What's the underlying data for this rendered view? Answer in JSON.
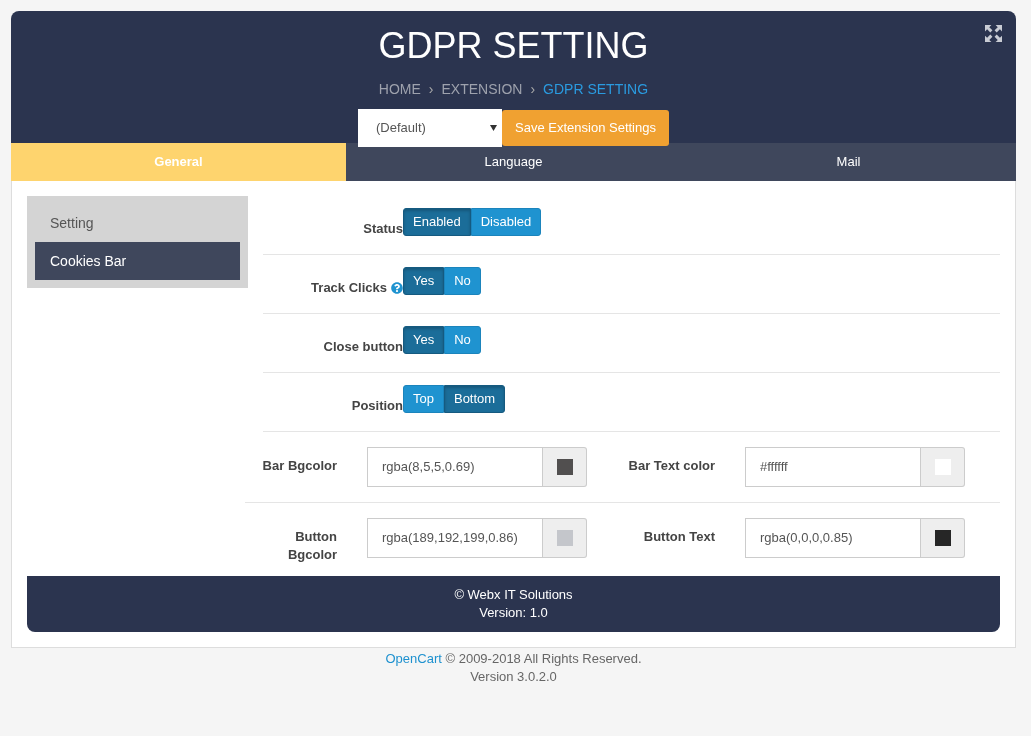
{
  "header": {
    "title": "GDPR SETTING",
    "breadcrumb_separator": "›",
    "breadcrumb": [
      {
        "label": "HOME",
        "current": false
      },
      {
        "label": "EXTENSION",
        "current": false
      },
      {
        "label": "GDPR SETTING",
        "current": true
      }
    ],
    "store_select": {
      "value": "(Default)"
    },
    "save_button": "Save Extension Settings"
  },
  "tabs": [
    {
      "label": "General",
      "selected": true
    },
    {
      "label": "Language",
      "selected": false
    },
    {
      "label": "Mail",
      "selected": false
    }
  ],
  "sidebar": {
    "items": [
      {
        "label": "Setting",
        "selected": false
      },
      {
        "label": "Cookies Bar",
        "selected": true
      }
    ]
  },
  "toggles": [
    {
      "label": "Status",
      "help": false,
      "options": [
        {
          "label": "Enabled",
          "selected": true
        },
        {
          "label": "Disabled",
          "selected": false
        }
      ]
    },
    {
      "label": "Track Clicks",
      "help": true,
      "options": [
        {
          "label": "Yes",
          "selected": true
        },
        {
          "label": "No",
          "selected": false
        }
      ]
    },
    {
      "label": "Close button",
      "help": false,
      "options": [
        {
          "label": "Yes",
          "selected": true
        },
        {
          "label": "No",
          "selected": false
        }
      ]
    },
    {
      "label": "Position",
      "help": false,
      "options": [
        {
          "label": "Top",
          "selected": false
        },
        {
          "label": "Bottom",
          "selected": true
        }
      ]
    }
  ],
  "color_rows": [
    [
      {
        "label": "Bar Bgcolor",
        "value": "rgba(8,5,5,0.69)",
        "color": "#514f4f"
      },
      {
        "label": "Bar Text color",
        "value": "#ffffff",
        "color": "#ffffff"
      }
    ],
    [
      {
        "label": "Button Bgcolor",
        "value": "rgba(189,192,199,0.86)",
        "color": "#c4c6cb"
      },
      {
        "label": "Button Text",
        "value": "rgba(0,0,0,0.85)",
        "color": "#262626"
      }
    ]
  ],
  "card_footer": {
    "lines": [
      "© Webx IT Solutions",
      "Version: 1.0"
    ]
  },
  "page_footer": {
    "link": "OpenCart",
    "text": "© 2009-2018 All Rights Reserved.",
    "version": "Version 3.0.2.0"
  }
}
